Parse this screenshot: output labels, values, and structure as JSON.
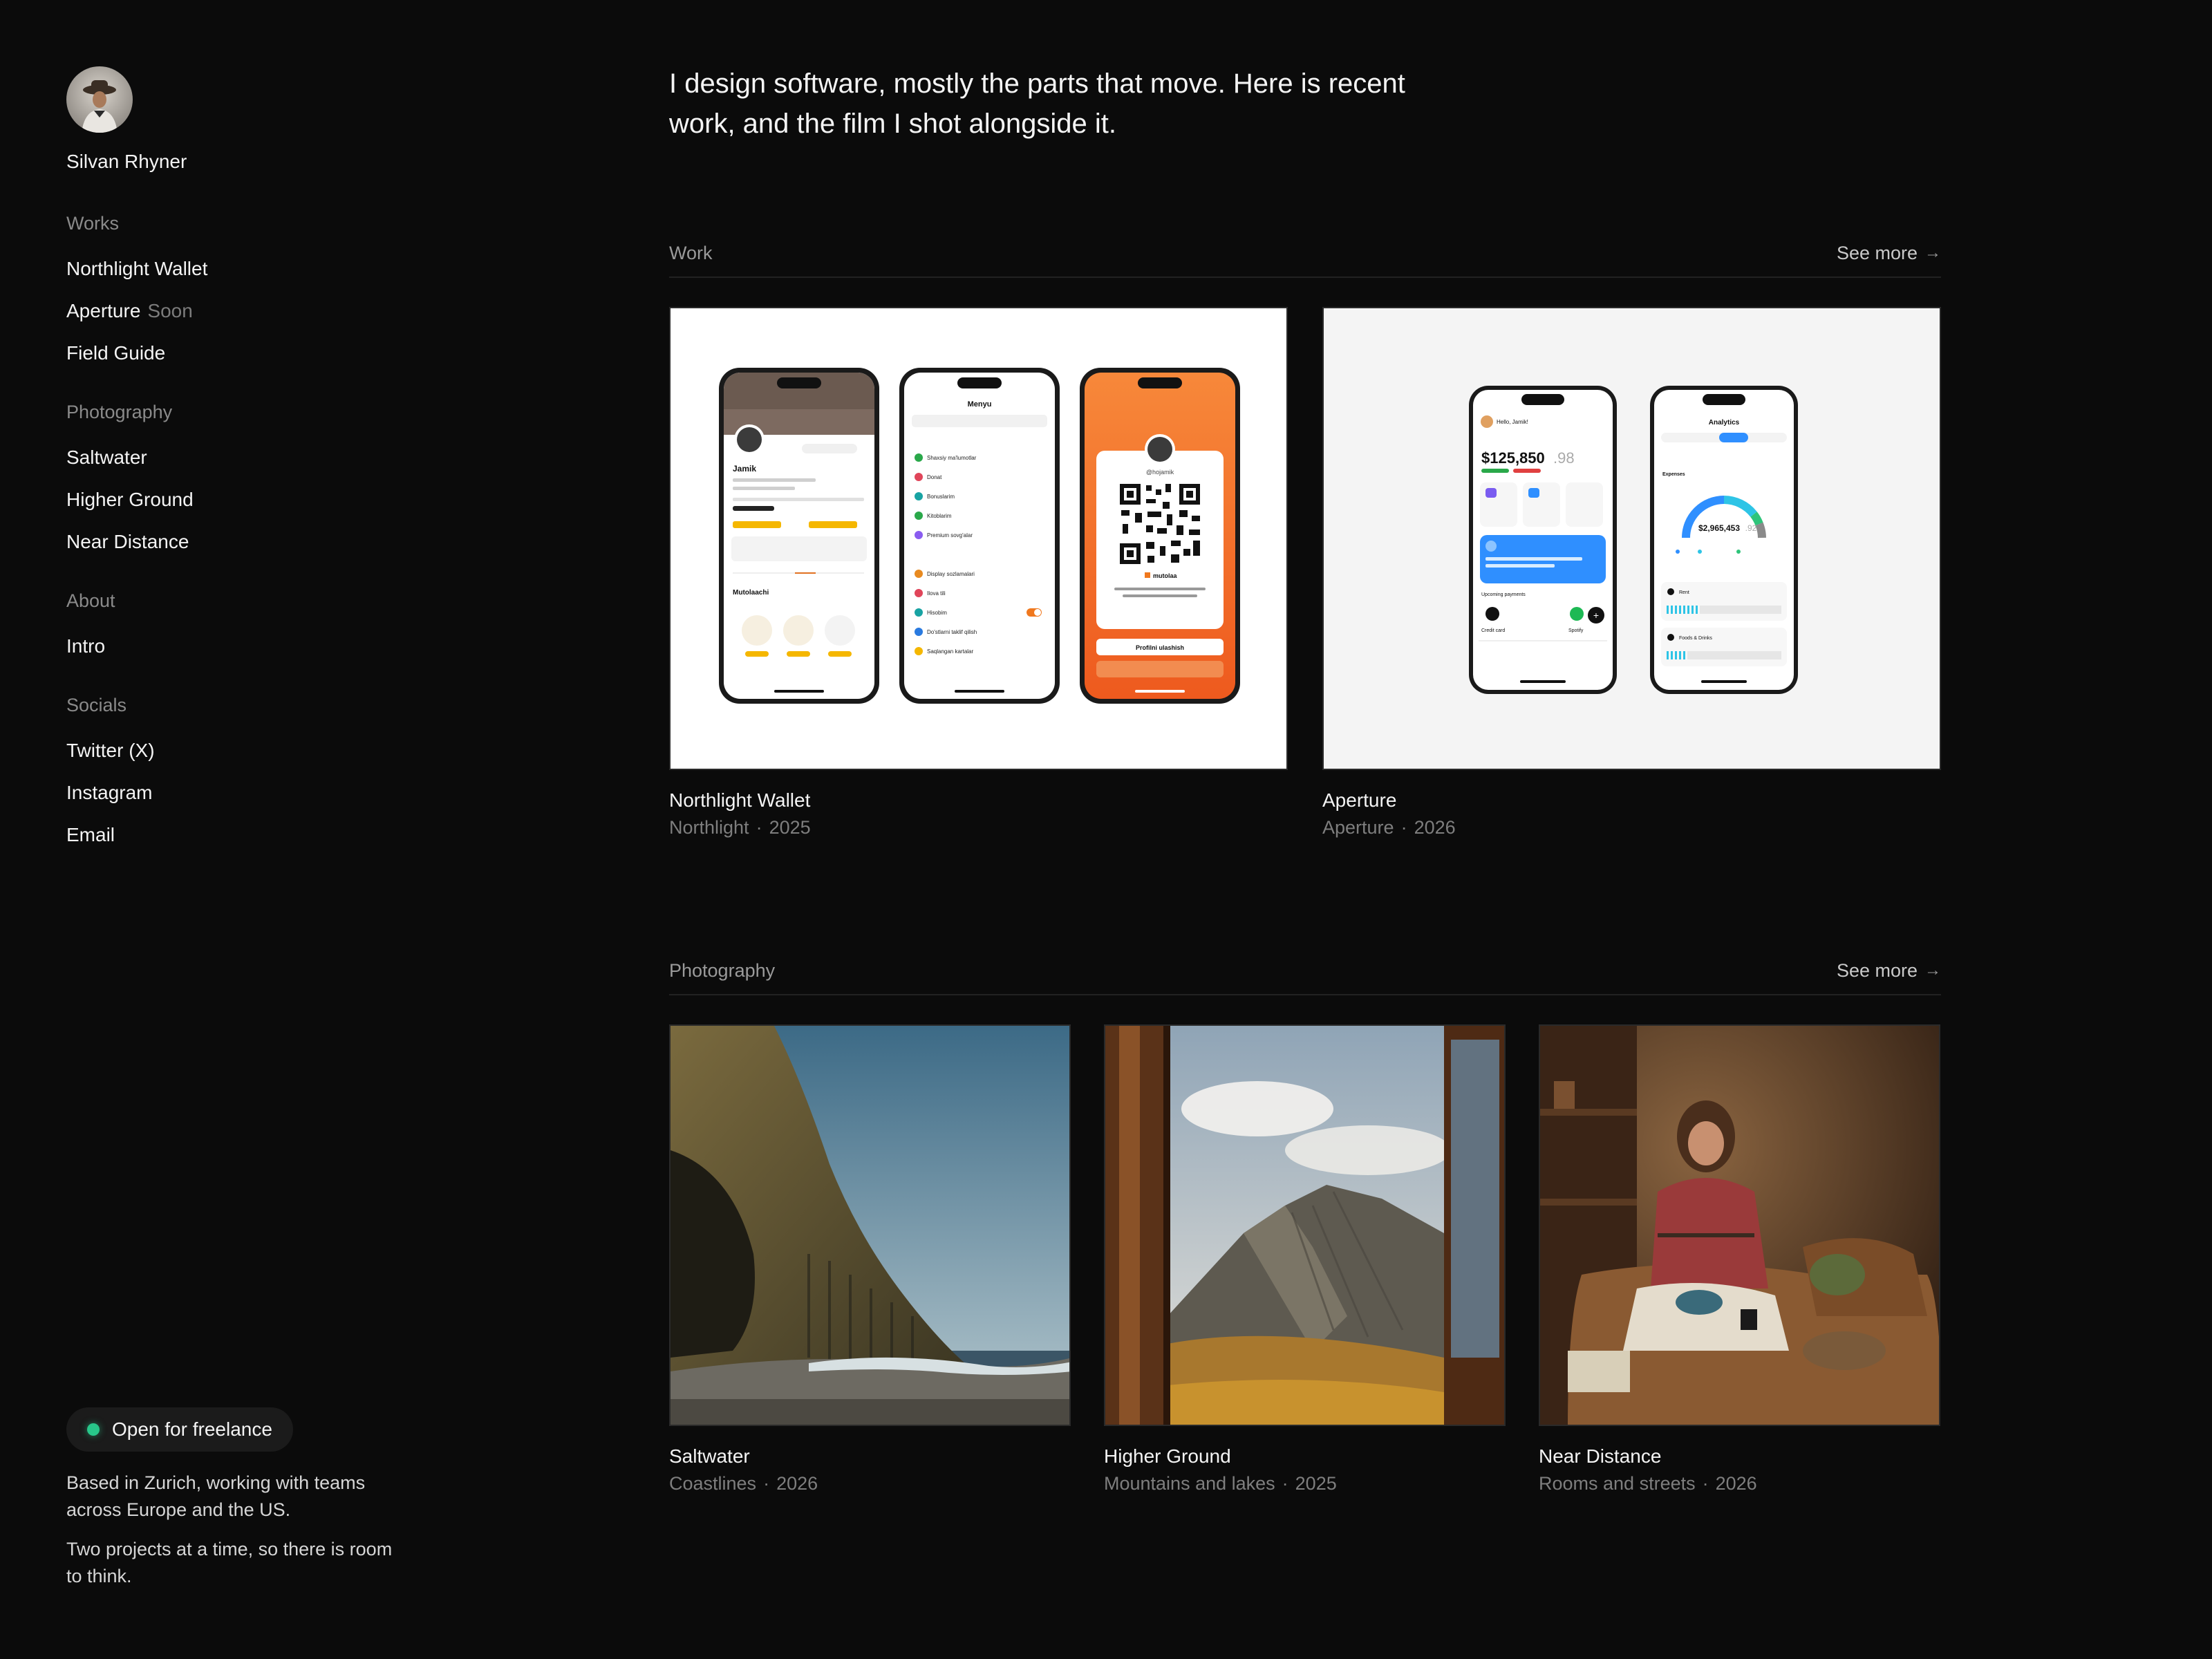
{
  "sidebar": {
    "name": "Silvan Rhyner",
    "groups": [
      {
        "heading": "Works",
        "links": [
          {
            "label": "Northlight Wallet"
          },
          {
            "label": "Aperture",
            "badge": "Soon"
          },
          {
            "label": "Field Guide"
          }
        ]
      },
      {
        "heading": "Photography",
        "links": [
          {
            "label": "Saltwater"
          },
          {
            "label": "Higher Ground"
          },
          {
            "label": "Near Distance"
          }
        ]
      },
      {
        "heading": "About",
        "links": [
          {
            "label": "Intro"
          }
        ]
      },
      {
        "heading": "Socials",
        "links": [
          {
            "label": "Twitter (X)"
          },
          {
            "label": "Instagram"
          },
          {
            "label": "Email"
          }
        ]
      }
    ],
    "freelance_label": "Open for freelance",
    "status_color": "#28c78a",
    "bio": [
      "Based in Zurich, working with teams across Europe and the US.",
      "Two projects at a time, so there is room to think."
    ]
  },
  "main": {
    "intro": "I design software, mostly the parts that move. Here is recent work, and the film I shot alongside it.",
    "work": {
      "title": "Work",
      "see_more": "See more",
      "items": [
        {
          "title": "Northlight Wallet",
          "client": "Northlight",
          "year": "2025"
        },
        {
          "title": "Aperture",
          "client": "Aperture",
          "year": "2026"
        }
      ]
    },
    "photography": {
      "title": "Photography",
      "see_more": "See more",
      "items": [
        {
          "title": "Saltwater",
          "subtitle": "Coastlines",
          "year": "2026"
        },
        {
          "title": "Higher Ground",
          "subtitle": "Mountains and lakes",
          "year": "2025"
        },
        {
          "title": "Near Distance",
          "subtitle": "Rooms and streets",
          "year": "2026"
        }
      ]
    }
  },
  "mockups": {
    "northlight": {
      "profile_name": "Jamik",
      "profile_handle": "@hojamik",
      "menu_title": "Menyu",
      "menu_items": [
        "Shaxsiy ma'lumotlar",
        "Donat",
        "Bonuslarim",
        "Kitoblarim",
        "Premium sovg'alar",
        "Display sozlamalari",
        "Ilova tili",
        "Hisobim",
        "Do'stlarni taklif qilish",
        "Saqlangan kartalar"
      ],
      "qr_handle": "@hojamik",
      "qr_brand": "mutolaa",
      "qr_caption": "\"Mutolaa\" - eng sara audio va elektron kitoblar.",
      "qr_button": "Profilni ulashish"
    },
    "aperture": {
      "greeting": "Hello, Jamik!",
      "balance": "$125,850",
      "balance_cents": ".98",
      "analytics_title": "Analytics",
      "expenses_label": "Expenses",
      "expenses_total": "$2,965,453",
      "expenses_cents": ".92",
      "credit_card_label": "Credit card",
      "spotify_label": "Spotify",
      "upcoming_label": "Upcoming payments",
      "rent_label": "Rent",
      "food_label": "Foods & Drinks"
    }
  }
}
